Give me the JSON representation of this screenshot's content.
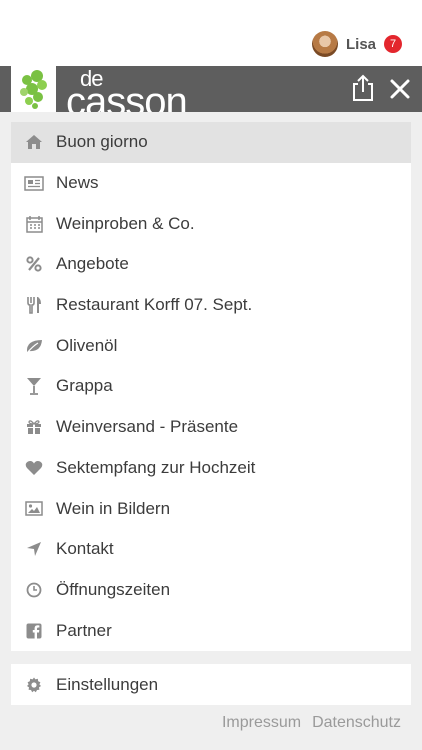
{
  "user": {
    "name": "Lisa",
    "notification_count": "7"
  },
  "brand": {
    "prefix": "de",
    "name": "casson"
  },
  "menu": {
    "items": [
      {
        "label": "Buon giorno",
        "icon": "home-icon",
        "active": true
      },
      {
        "label": "News",
        "icon": "newspaper-icon"
      },
      {
        "label": "Weinproben & Co.",
        "icon": "calendar-icon"
      },
      {
        "label": "Angebote",
        "icon": "percent-icon"
      },
      {
        "label": "Restaurant Korff 07. Sept.",
        "icon": "cutlery-icon"
      },
      {
        "label": "Olivenöl",
        "icon": "leaf-icon"
      },
      {
        "label": "Grappa",
        "icon": "glass-icon"
      },
      {
        "label": "Weinversand - Präsente",
        "icon": "gift-icon"
      },
      {
        "label": "Sektempfang zur Hochzeit",
        "icon": "heart-icon"
      },
      {
        "label": "Wein in Bildern",
        "icon": "picture-icon"
      },
      {
        "label": "Kontakt",
        "icon": "location-arrow-icon"
      },
      {
        "label": "Öffnungszeiten",
        "icon": "clock-icon"
      },
      {
        "label": "Partner",
        "icon": "facebook-icon"
      }
    ],
    "settings_label": "Einstellungen"
  },
  "footer": {
    "impressum": "Impressum",
    "datenschutz": "Datenschutz"
  },
  "colors": {
    "brand_bar": "#5e5e5e",
    "accent_green": "#7ac143",
    "badge_red": "#e3262d",
    "icon_gray": "#8c8c8c"
  }
}
